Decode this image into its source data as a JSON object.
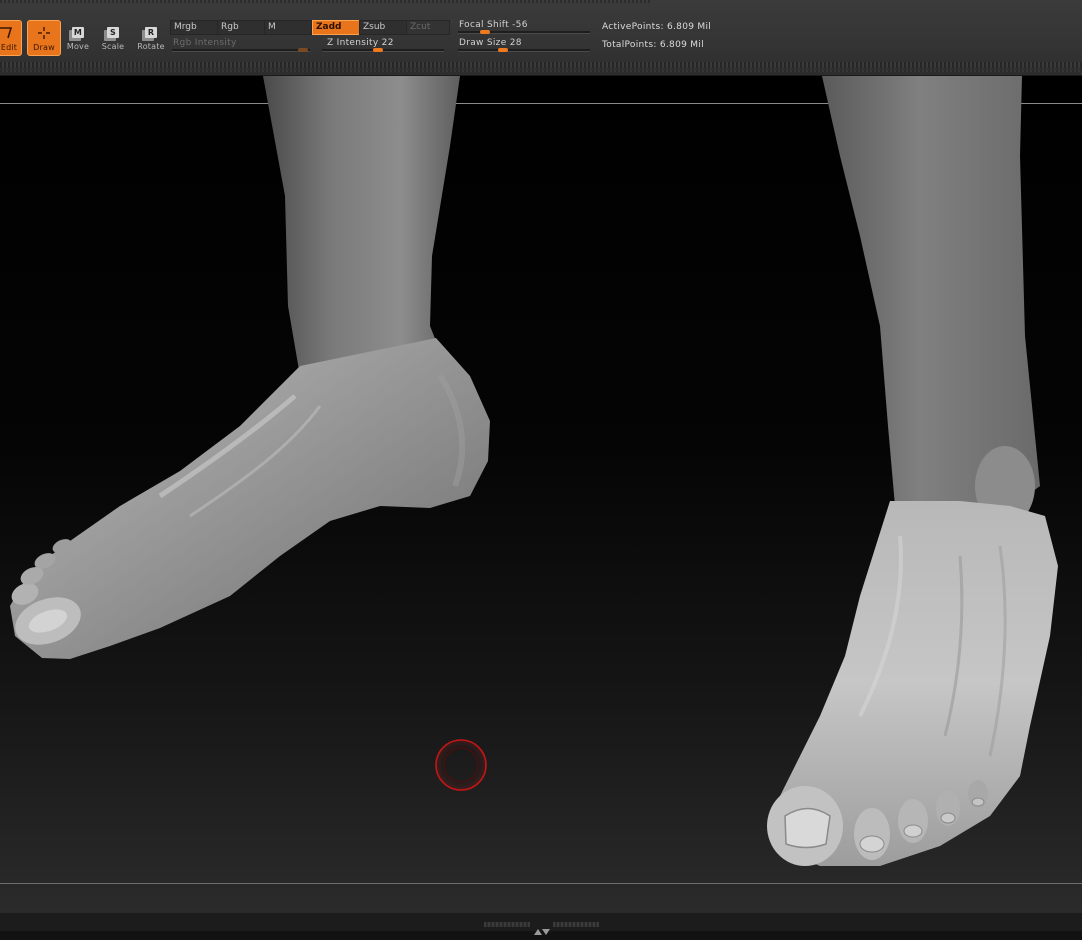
{
  "toolbar": {
    "tools": [
      {
        "label": "Edit",
        "icon": "edit-icon",
        "active": true
      },
      {
        "label": "Draw",
        "icon": "draw-icon",
        "active": true
      },
      {
        "label": "Move",
        "icon": "move-icon",
        "glyph": "M",
        "active": false
      },
      {
        "label": "Scale",
        "icon": "scale-icon",
        "glyph": "S",
        "active": false
      },
      {
        "label": "Rotate",
        "icon": "rotate-icon",
        "glyph": "R",
        "active": false
      }
    ],
    "modes": {
      "mrgb": "Mrgb",
      "rgb": "Rgb",
      "m": "M",
      "zadd": "Zadd",
      "zsub": "Zsub",
      "zcut": "Zcut"
    },
    "rgb_intensity": {
      "label": "Rgb  Intensity",
      "enabled": false
    },
    "z_intensity": {
      "label": "Z  Intensity",
      "value": "22"
    },
    "focal_shift": {
      "label": "Focal  Shift",
      "value": "-56"
    },
    "draw_size": {
      "label": "Draw  Size",
      "value": "28"
    },
    "stats": {
      "active_points_label": "ActivePoints:",
      "active_points_value": "6.809  Mil",
      "total_points_label": "TotalPoints:",
      "total_points_value": "6.809  Mil"
    }
  },
  "viewport": {
    "model": "sculpted-feet-mesh",
    "brush_cursor_color": "#d01818"
  },
  "colors": {
    "accent": "#e8741c",
    "toolbar_bg": "#3b3b3b",
    "viewport_top": "#000000",
    "viewport_bottom": "#2b2b2b"
  }
}
